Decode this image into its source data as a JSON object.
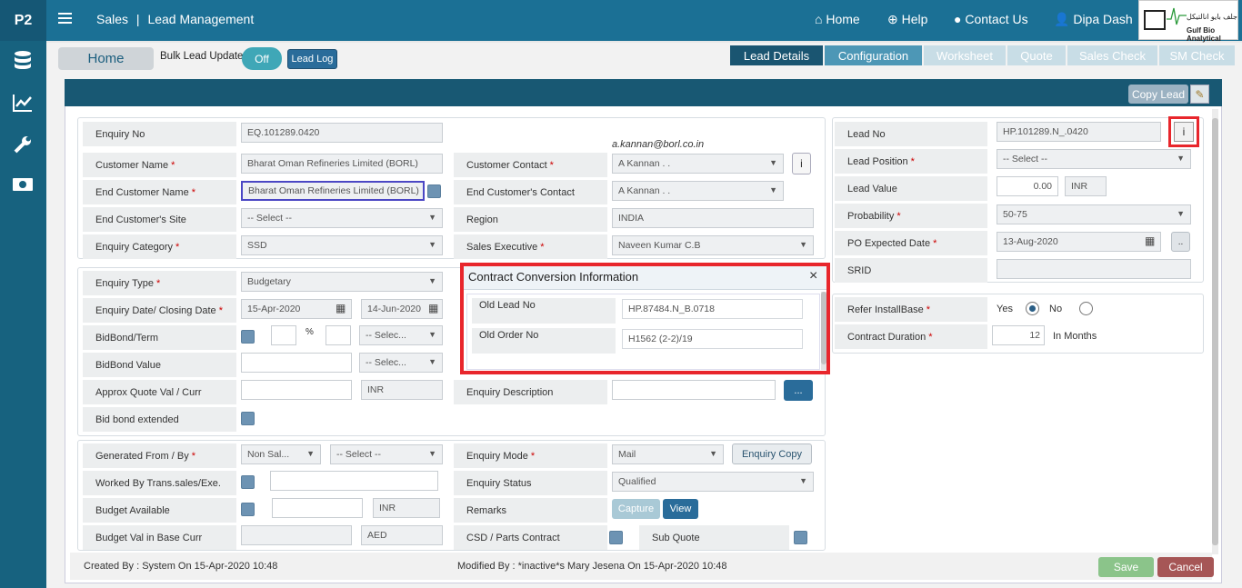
{
  "app": {
    "logo_text": "P2",
    "section": "Sales",
    "page": "Lead Management",
    "separator": "|"
  },
  "topnav": {
    "home": "Home",
    "help": "Help",
    "contact": "Contact Us",
    "user": "Dipa Dash"
  },
  "logo": {
    "arabic": "جلف بايو انالتيكل",
    "english": "Gulf Bio Analytical"
  },
  "toolbar": {
    "home": "Home",
    "bulk_label": "Bulk Lead Update",
    "toggle": "Off",
    "lead_log": "Lead Log"
  },
  "tabs": [
    "Lead Details",
    "Configuration",
    "Worksheet",
    "Quote",
    "Sales Check",
    "SM Check"
  ],
  "panel": {
    "copy_lead": "Copy Lead"
  },
  "left": {
    "enquiry_no": {
      "label": "Enquiry No",
      "value": "EQ.101289.0420"
    },
    "customer_name": {
      "label": "Customer Name",
      "value": "Bharat Oman Refineries Limited (BORL)"
    },
    "end_customer_name": {
      "label": "End Customer Name",
      "value": "Bharat Oman Refineries Limited (BORL)"
    },
    "end_customer_site": {
      "label": "End Customer's Site",
      "value": "-- Select --"
    },
    "enquiry_category": {
      "label": "Enquiry Category",
      "value": "SSD"
    },
    "email": "a.kannan@borl.co.in",
    "customer_contact": {
      "label": "Customer Contact",
      "value": "A Kannan  . ."
    },
    "end_customer_contact": {
      "label": "End Customer's Contact",
      "value": "A Kannan  . ."
    },
    "region": {
      "label": "Region",
      "value": "INDIA"
    },
    "sales_exec": {
      "label": "Sales Executive",
      "value": "Naveen Kumar C.B"
    },
    "enquiry_type": {
      "label": "Enquiry Type",
      "value": "Budgetary"
    },
    "enquiry_date": {
      "label": "Enquiry Date/ Closing Date",
      "value1": "15-Apr-2020",
      "value2": "14-Jun-2020"
    },
    "bidbond_term": {
      "label": "BidBond/Term",
      "pct": "%",
      "select": "-- Selec..."
    },
    "bidbond_value": {
      "label": "BidBond Value",
      "select": "-- Selec..."
    },
    "approx_quote": {
      "label": "Approx Quote Val / Curr",
      "curr": "INR"
    },
    "bid_ext": {
      "label": "Bid bond extended"
    },
    "enquiry_desc": {
      "label": "Enquiry Description",
      "btn": "..."
    },
    "generated": {
      "label": "Generated From / By",
      "v1": "Non Sal...",
      "v2": "-- Select --"
    },
    "worked_by": {
      "label": "Worked By Trans.sales/Exe."
    },
    "budget_avail": {
      "label": "Budget Available",
      "curr": "INR"
    },
    "budget_base": {
      "label": "Budget Val in Base Curr",
      "curr": "AED"
    },
    "enquiry_mode": {
      "label": "Enquiry Mode",
      "value": "Mail",
      "btn": "Enquiry Copy"
    },
    "enquiry_status": {
      "label": "Enquiry Status",
      "value": "Qualified"
    },
    "remarks": {
      "label": "Remarks",
      "capture": "Capture",
      "view": "View"
    },
    "csd": {
      "label": "CSD / Parts Contract"
    },
    "sub_quote": {
      "label": "Sub Quote"
    }
  },
  "right": {
    "lead_no": {
      "label": "Lead No",
      "value": "HP.101289.N_.0420",
      "info": "i"
    },
    "lead_position": {
      "label": "Lead Position",
      "value": "-- Select --"
    },
    "lead_value": {
      "label": "Lead Value",
      "value": "0.00",
      "curr": "INR"
    },
    "probability": {
      "label": "Probability",
      "value": "50-75"
    },
    "po_date": {
      "label": "PO Expected Date",
      "value": "13-Aug-2020",
      "btn": ".."
    },
    "srid": {
      "label": "SRID"
    },
    "refer_install": {
      "label": "Refer InstallBase",
      "yes": "Yes",
      "no": "No"
    },
    "contract_duration": {
      "label": "Contract Duration",
      "value": "12",
      "unit": "In Months"
    }
  },
  "modal": {
    "title": "Contract Conversion Information",
    "close": "×",
    "rows": [
      {
        "label": "Old Lead No",
        "value": "HP.87484.N_B.0718"
      },
      {
        "label": "Old Order No",
        "value": "H1562 (2-2)/19"
      }
    ]
  },
  "footer": {
    "created": "Created By : System On 15-Apr-2020 10:48",
    "modified": "Modified By : *inactive*s Mary Jesena On 15-Apr-2020 10:48",
    "save": "Save",
    "cancel": "Cancel"
  },
  "colors": {
    "topbar": "#1b7095",
    "sidebar": "#17627f",
    "panel_header": "#185873",
    "highlight": "#e8262c",
    "save": "#8bc48a",
    "cancel": "#a65656"
  }
}
